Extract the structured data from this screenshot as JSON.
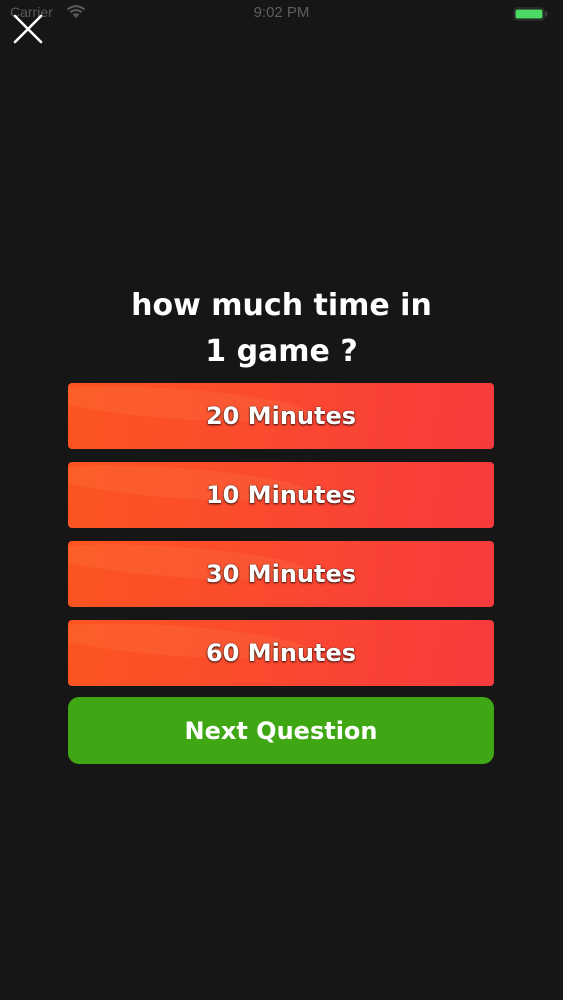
{
  "status_bar": {
    "carrier": "Carrier",
    "time": "9:02 PM",
    "battery_color": "#4cd964"
  },
  "close_button": {
    "icon": "close-icon"
  },
  "question": {
    "line1": "how much time in",
    "line2": "1 game ?"
  },
  "answers": [
    {
      "label": "20 Minutes"
    },
    {
      "label": "10 Minutes"
    },
    {
      "label": "30 Minutes"
    },
    {
      "label": "60 Minutes"
    }
  ],
  "next_button": {
    "label": "Next Question",
    "color": "#3ea713"
  },
  "colors": {
    "background": "#171617",
    "answer_gradient_start": "#fc5520",
    "answer_gradient_end": "#f73a3d"
  }
}
